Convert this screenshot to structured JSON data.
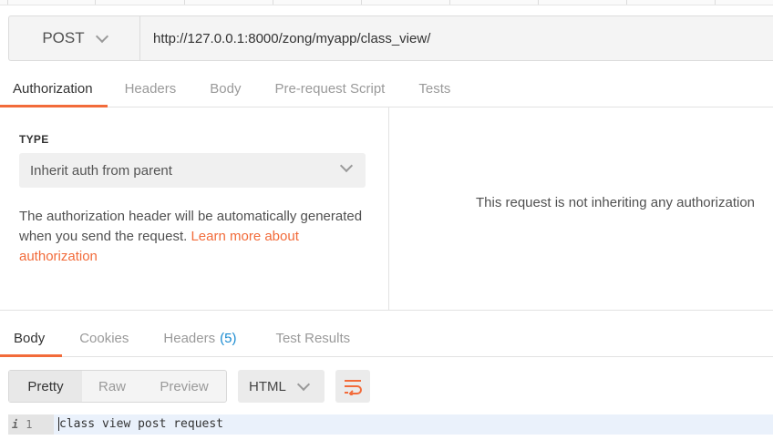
{
  "request": {
    "method": "POST",
    "url": "http://127.0.0.1:8000/zong/myapp/class_view/"
  },
  "request_tabs": [
    {
      "label": "Authorization",
      "active": true
    },
    {
      "label": "Headers",
      "active": false
    },
    {
      "label": "Body",
      "active": false
    },
    {
      "label": "Pre-request Script",
      "active": false
    },
    {
      "label": "Tests",
      "active": false
    }
  ],
  "auth": {
    "type_label": "TYPE",
    "type_value": "Inherit auth from parent",
    "description": "The authorization header will be automatically generated when you send the request.",
    "link_text": "Learn more about authorization",
    "message": "This request is not inheriting any authorization"
  },
  "response_tabs": [
    {
      "label": "Body",
      "active": true
    },
    {
      "label": "Cookies",
      "active": false
    },
    {
      "label": "Headers",
      "badge": "(5)",
      "active": false
    },
    {
      "label": "Test Results",
      "active": false
    }
  ],
  "view_modes": [
    {
      "label": "Pretty",
      "active": true
    },
    {
      "label": "Raw",
      "active": false
    },
    {
      "label": "Preview",
      "active": false
    }
  ],
  "format": "HTML",
  "editor": {
    "line_number": "1",
    "info_icon": "i",
    "line_text": "class view post request"
  },
  "colors": {
    "accent": "#f26b3a",
    "badge": "#1a8bd1"
  },
  "icons": [
    "chevron-down-icon",
    "wrap-lines-icon",
    "info-icon"
  ]
}
